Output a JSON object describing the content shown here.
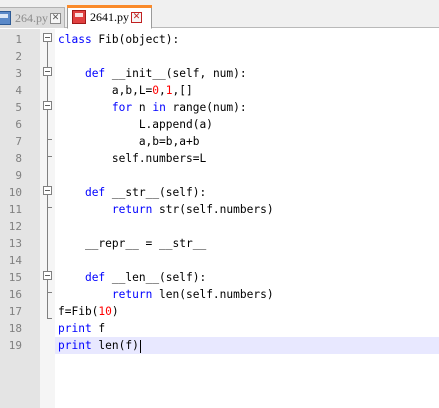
{
  "tabs": [
    {
      "label": "264.py",
      "active": false
    },
    {
      "label": "2641.py",
      "active": true
    }
  ],
  "code_lines": [
    {
      "n": "1",
      "html": "<span class='kw'>class</span> Fib(object):"
    },
    {
      "n": "2",
      "html": ""
    },
    {
      "n": "3",
      "html": "    <span class='kw'>def</span> __init__(self, num):"
    },
    {
      "n": "4",
      "html": "        a,b,L=<span class='num'>0</span>,<span class='num'>1</span>,[]"
    },
    {
      "n": "5",
      "html": "        <span class='kw'>for</span> n <span class='kw'>in</span> range(num):"
    },
    {
      "n": "6",
      "html": "            L.append(a)"
    },
    {
      "n": "7",
      "html": "            a,b=b,a+b"
    },
    {
      "n": "8",
      "html": "        self.numbers=L"
    },
    {
      "n": "9",
      "html": ""
    },
    {
      "n": "10",
      "html": "    <span class='kw'>def</span> __str__(self):"
    },
    {
      "n": "11",
      "html": "        <span class='kw'>return</span> str(self.numbers)"
    },
    {
      "n": "12",
      "html": ""
    },
    {
      "n": "13",
      "html": "    __repr__ = __str__"
    },
    {
      "n": "14",
      "html": ""
    },
    {
      "n": "15",
      "html": "    <span class='kw'>def</span> __len__(self):"
    },
    {
      "n": "16",
      "html": "        <span class='kw'>return</span> len(self.numbers)"
    },
    {
      "n": "17",
      "html": "f=Fib(<span class='num'>10</span>)"
    },
    {
      "n": "18",
      "html": "<span class='kw'>print</span> f"
    },
    {
      "n": "19",
      "html": "<span class='kw'>print</span> len(f)"
    }
  ],
  "current_line": 19,
  "colors": {
    "keyword": "#0000ff",
    "number": "#ff0000",
    "current_line": "#e8e8ff",
    "active_tab_accent": "#fa8a2a"
  }
}
